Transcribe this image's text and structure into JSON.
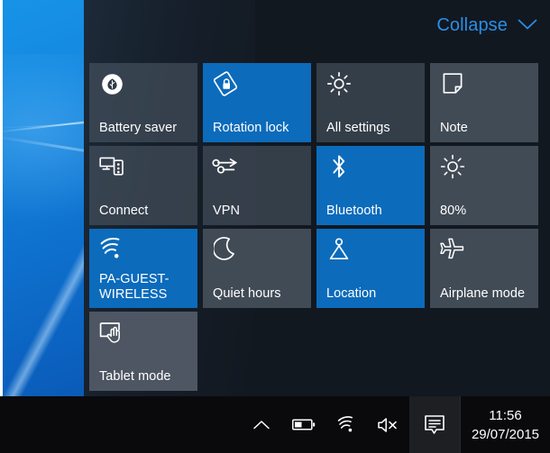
{
  "desktop": {
    "name": "windows-10-hero-wallpaper"
  },
  "action_center": {
    "header": {
      "collapse_label": "Collapse",
      "chevron_icon": "chevron-down-icon",
      "accent_color": "#2a8ee8"
    },
    "colors": {
      "panel_background": "#121820",
      "tile_active": "#0c6bbb",
      "tile_inactive": "#48525d",
      "tile_hover": "#505a65"
    },
    "tiles": [
      {
        "label": "Battery saver",
        "icon": "battery-saver-icon",
        "state": "inactive",
        "translucent": true
      },
      {
        "label": "Rotation lock",
        "icon": "rotation-lock-icon",
        "state": "active",
        "translucent": false
      },
      {
        "label": "All settings",
        "icon": "gear-icon",
        "state": "inactive",
        "translucent": true
      },
      {
        "label": "Note",
        "icon": "note-icon",
        "state": "inactive",
        "translucent": false
      },
      {
        "label": "Connect",
        "icon": "connect-icon",
        "state": "inactive",
        "translucent": true
      },
      {
        "label": "VPN",
        "icon": "vpn-icon",
        "state": "inactive",
        "translucent": true
      },
      {
        "label": "Bluetooth",
        "icon": "bluetooth-icon",
        "state": "active",
        "translucent": false
      },
      {
        "label": "80%",
        "icon": "brightness-icon",
        "state": "inactive",
        "translucent": false
      },
      {
        "label": "PA-GUEST-\nWIRELESS",
        "icon": "wifi-icon",
        "state": "active",
        "translucent": false
      },
      {
        "label": "Quiet hours",
        "icon": "moon-icon",
        "state": "inactive",
        "translucent": false
      },
      {
        "label": "Location",
        "icon": "location-icon",
        "state": "active",
        "translucent": false
      },
      {
        "label": "Airplane mode",
        "icon": "airplane-icon",
        "state": "inactive",
        "translucent": false
      },
      {
        "label": "Tablet mode",
        "icon": "tablet-mode-icon",
        "state": "hover",
        "translucent": false
      }
    ]
  },
  "taskbar": {
    "tray": [
      {
        "name": "show-hidden-icons-icon",
        "label": "Show hidden icons"
      },
      {
        "name": "battery-icon",
        "label": "Battery"
      },
      {
        "name": "wifi-icon",
        "label": "Network"
      },
      {
        "name": "volume-muted-icon",
        "label": "Volume muted"
      },
      {
        "name": "action-center-icon",
        "label": "Action Center"
      }
    ],
    "clock": {
      "time": "11:56",
      "date": "29/07/2015"
    }
  }
}
